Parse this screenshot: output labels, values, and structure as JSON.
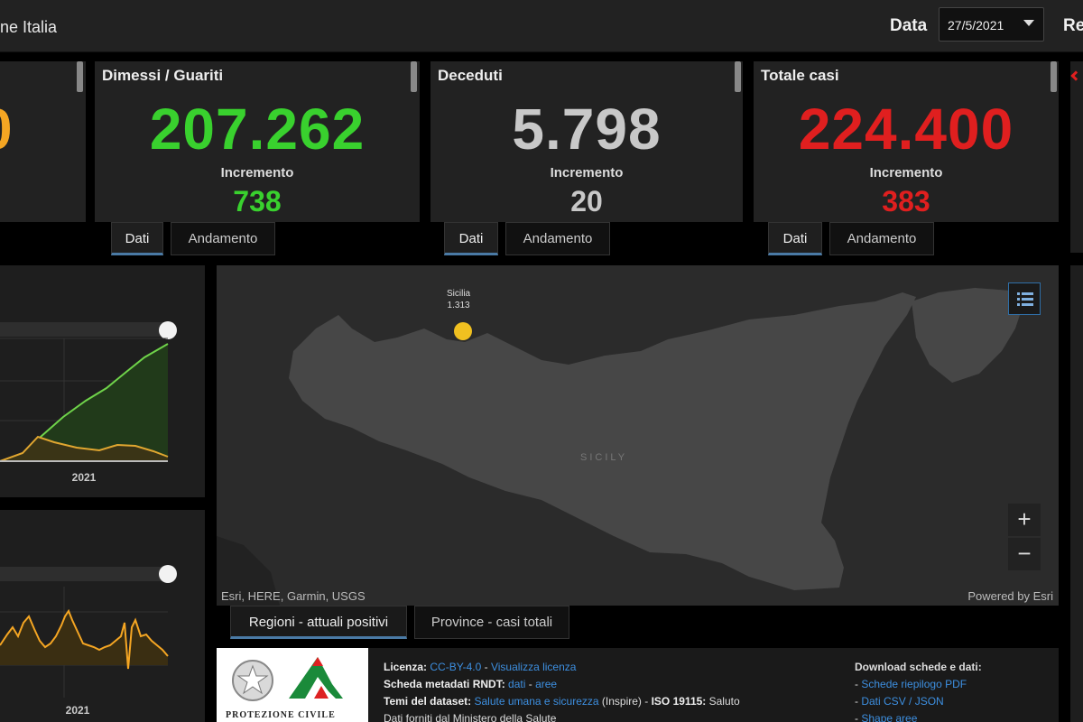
{
  "header": {
    "title": "ne Italia",
    "date_label": "Data",
    "date_value": "27/5/2021",
    "right_label": "Re"
  },
  "cards": {
    "first": {
      "value": "0",
      "color": "#f5a623"
    },
    "guariti": {
      "title": "Dimessi / Guariti",
      "value": "207.262",
      "inc_label": "Incremento",
      "inc_value": "738",
      "color": "#39d12e"
    },
    "deceduti": {
      "title": "Deceduti",
      "value": "5.798",
      "inc_label": "Incremento",
      "inc_value": "20",
      "color": "#c8c8c8"
    },
    "totale": {
      "title": "Totale casi",
      "value": "224.400",
      "inc_label": "Incremento",
      "inc_value": "383",
      "color": "#e01f1f"
    }
  },
  "tabs": {
    "dati": "Dati",
    "andamento": "Andamento"
  },
  "charts": {
    "upper_year": "2021",
    "lower_year": "2021"
  },
  "map": {
    "point_label_1": "Sicilia",
    "point_label_2": "1.313",
    "region_label": "SICILY",
    "credit_left": "Esri, HERE, Garmin, USGS",
    "credit_right": "Powered by Esri",
    "zoom_in": "+",
    "zoom_out": "−"
  },
  "bottom_tabs": {
    "regioni": "Regioni - attuali positivi",
    "province": "Province - casi totali"
  },
  "footer": {
    "logo_text": "PROTEZIONE CIVILE",
    "licenza_label": "Licenza:",
    "licenza_link1": "CC-BY-4.0",
    "licenza_sep": " - ",
    "licenza_link2": "Visualizza licenza",
    "scheda_label": "Scheda metadati RNDT:",
    "scheda_link1": "dati",
    "scheda_link2": "aree",
    "temi_label": "Temi del dataset:",
    "temi_link": "Salute umana e sicurezza",
    "temi_rest": " (Inspire) - ",
    "temi_iso": "ISO 19115:",
    "temi_end": " Saluto",
    "fonte": "Dati forniti dal Ministero della Salute",
    "download_title": "Download schede e dati:",
    "download_1": "Schede riepilogo PDF",
    "download_2": "Dati CSV / JSON",
    "download_3": "Shape aree"
  },
  "colors": {
    "green": "#39d12e",
    "orange": "#f5a623",
    "red": "#e01f1f",
    "gray": "#c8c8c8",
    "link": "#3d8fe0"
  }
}
